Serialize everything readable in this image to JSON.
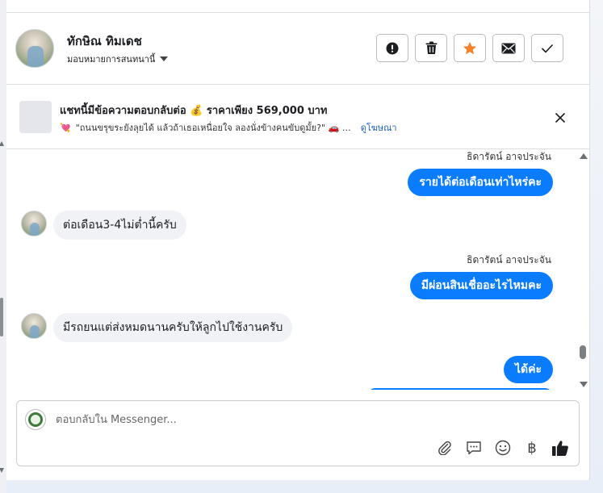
{
  "header": {
    "contact_name": "ทักษิณ ทิมเดช",
    "assign_label": "มอบหมายการสนทนานี้",
    "actions": [
      {
        "name": "exclamation-icon"
      },
      {
        "name": "trash-icon"
      },
      {
        "name": "star-icon"
      },
      {
        "name": "envelope-icon"
      },
      {
        "name": "check-icon"
      }
    ]
  },
  "ad": {
    "title": "แชทนี้มีข้อความตอบกลับต่อ 💰 ราคาเพียง 569,000 บาท",
    "subtitle": "\"ถนนขรุขระยังลุยได้ แล้วถ้าเธอเหนื่อยใจ ลองนั่งข้างคนขับดูมั้ย?\" 🚗 …",
    "subtitle_emoji": "💘",
    "link_label": "ดูโฆษณา"
  },
  "messages": [
    {
      "direction": "out",
      "sender": "ธิดารัตน์ อาจประจัน",
      "text": "รายได้ต่อเดือนเท่าไหร่คะ"
    },
    {
      "direction": "in",
      "text": "ต่อเดือน3-4ไม่ต่ำนี้ครับ"
    },
    {
      "direction": "out",
      "sender": "ธิดารัตน์ อาจประจัน",
      "text": "มีผ่อนสินเชื่ออะไรไหมคะ"
    },
    {
      "direction": "in",
      "text": "มีรถยนแต่ส่งหมดนานครับให้ลูกไปใช้งานครับ"
    },
    {
      "direction": "out",
      "text": "ได้ค่ะ"
    }
  ],
  "composer": {
    "placeholder": "ตอบกลับใน Messenger...",
    "currency_symbol": "฿"
  },
  "colors": {
    "accent": "#0a7cff",
    "star": "#f5822a"
  }
}
